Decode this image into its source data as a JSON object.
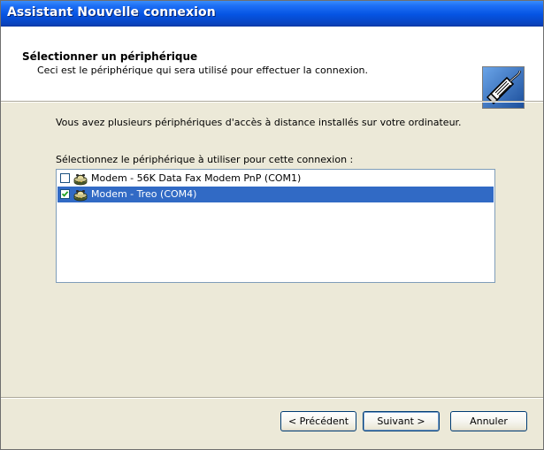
{
  "window": {
    "title": "Assistant Nouvelle connexion"
  },
  "header": {
    "title": "Sélectionner un périphérique",
    "subtitle": "Ceci est le périphérique qui sera utilisé pour effectuer la connexion.",
    "icon": "phone-connector-icon"
  },
  "body": {
    "intro": "Vous avez plusieurs périphériques d'accès à distance installés sur votre ordinateur.",
    "select_label": "Sélectionnez le périphérique à utiliser pour cette connexion :"
  },
  "devices": [
    {
      "label": "Modem - 56K Data Fax Modem PnP (COM1)",
      "checked": false,
      "selected": false,
      "icon": "modem-icon"
    },
    {
      "label": "Modem - Treo (COM4)",
      "checked": true,
      "selected": true,
      "icon": "modem-icon"
    }
  ],
  "buttons": {
    "back": "< Précédent",
    "next": "Suivant >",
    "cancel": "Annuler"
  },
  "colors": {
    "titlebar": "#0554e3",
    "selection": "#316ac5",
    "dialog_bg": "#ece9d8"
  }
}
